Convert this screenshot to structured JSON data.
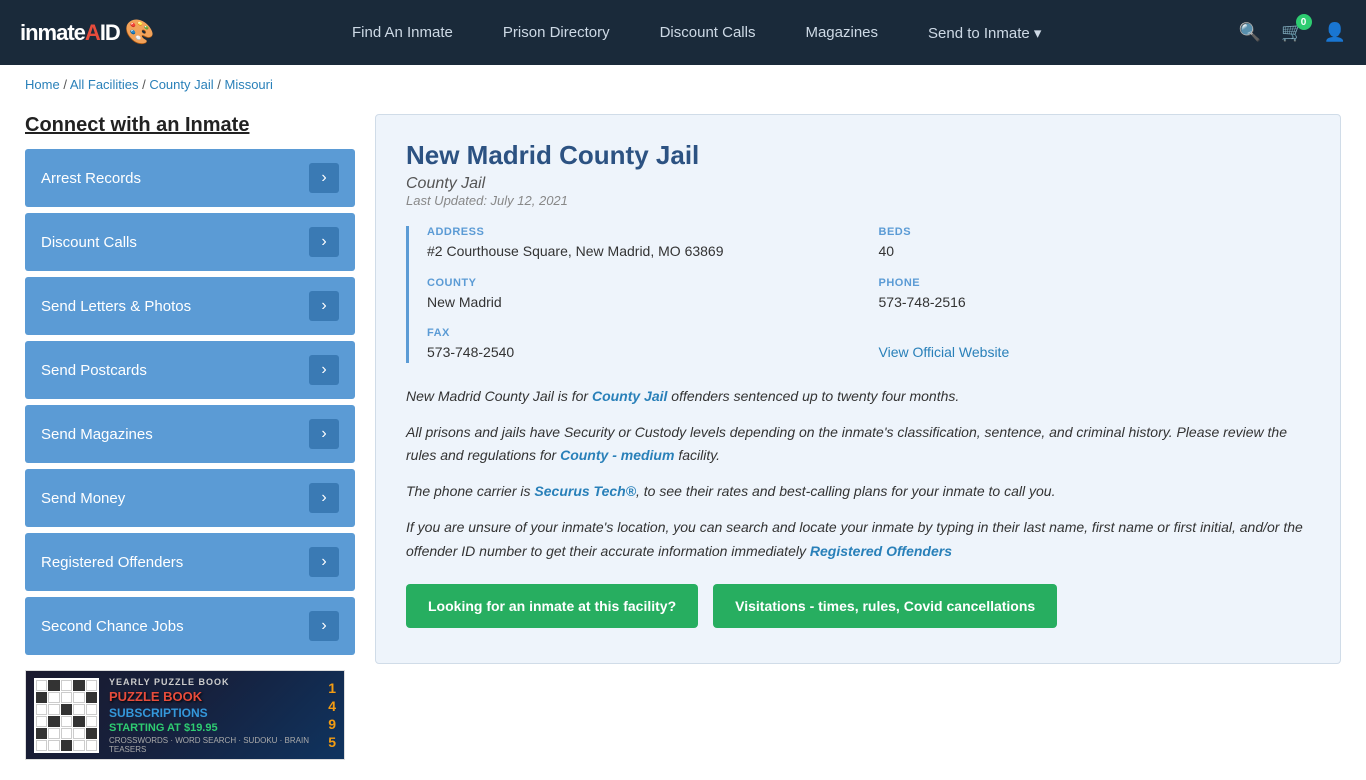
{
  "navbar": {
    "logo": "inmateAID",
    "links": [
      {
        "label": "Find An Inmate",
        "id": "find-inmate"
      },
      {
        "label": "Prison Directory",
        "id": "prison-directory"
      },
      {
        "label": "Discount Calls",
        "id": "discount-calls"
      },
      {
        "label": "Magazines",
        "id": "magazines"
      },
      {
        "label": "Send to Inmate ▾",
        "id": "send-to-inmate"
      }
    ],
    "cart_count": "0"
  },
  "breadcrumb": {
    "home": "Home",
    "all_facilities": "All Facilities",
    "county_jail": "County Jail",
    "state": "Missouri"
  },
  "sidebar": {
    "title": "Connect with an Inmate",
    "items": [
      {
        "label": "Arrest Records",
        "id": "arrest-records"
      },
      {
        "label": "Discount Calls",
        "id": "discount-calls"
      },
      {
        "label": "Send Letters & Photos",
        "id": "send-letters"
      },
      {
        "label": "Send Postcards",
        "id": "send-postcards"
      },
      {
        "label": "Send Magazines",
        "id": "send-magazines"
      },
      {
        "label": "Send Money",
        "id": "send-money"
      },
      {
        "label": "Registered Offenders",
        "id": "registered-offenders"
      },
      {
        "label": "Second Chance Jobs",
        "id": "second-chance-jobs"
      }
    ],
    "ad": {
      "yearly": "YEARLY PUZZLE BOOK",
      "subscriptions": "SUBSCRIPTIONS",
      "starting": "STARTING AT $19.95",
      "types": "CROSSWORDS · WORD SEARCH · SUDOKU · BRAIN TEASERS"
    }
  },
  "facility": {
    "name": "New Madrid County Jail",
    "type": "County Jail",
    "last_updated": "Last Updated: July 12, 2021",
    "address_label": "ADDRESS",
    "address_value": "#2 Courthouse Square, New Madrid, MO 63869",
    "beds_label": "BEDS",
    "beds_value": "40",
    "county_label": "COUNTY",
    "county_value": "New Madrid",
    "phone_label": "PHONE",
    "phone_value": "573-748-2516",
    "fax_label": "FAX",
    "fax_value": "573-748-2540",
    "website_label": "View Official Website",
    "website_url": "#",
    "desc1": "New Madrid County Jail is for County Jail offenders sentenced up to twenty four months.",
    "desc2": "All prisons and jails have Security or Custody levels depending on the inmate's classification, sentence, and criminal history. Please review the rules and regulations for County - medium facility.",
    "desc3": "The phone carrier is Securus Tech®, to see their rates and best-calling plans for your inmate to call you.",
    "desc4": "If you are unsure of your inmate's location, you can search and locate your inmate by typing in their last name, first name or first initial, and/or the offender ID number to get their accurate information immediately Registered Offenders",
    "btn_looking": "Looking for an inmate at this facility?",
    "btn_visitations": "Visitations - times, rules, Covid cancellations"
  }
}
